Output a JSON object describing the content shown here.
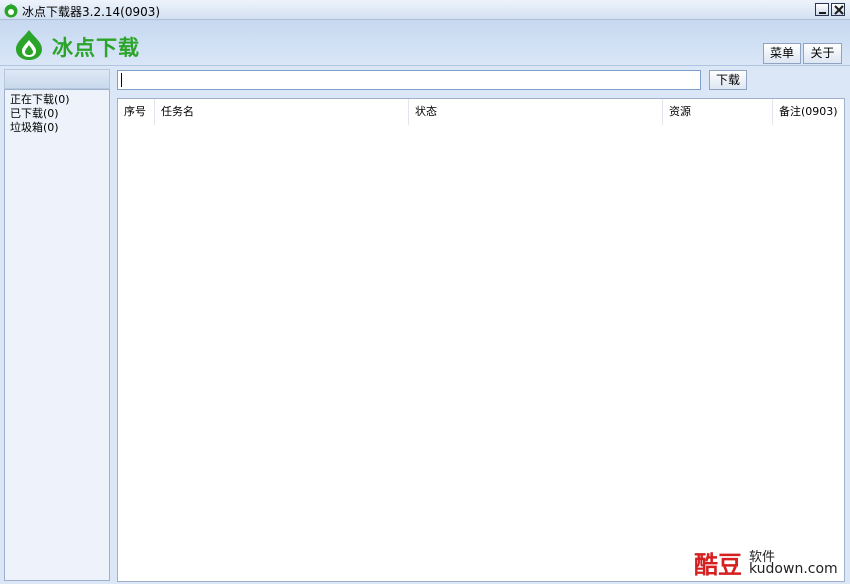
{
  "window": {
    "title": "冰点下载器3.2.14(0903)",
    "minimize_icon": "minimize-icon",
    "close_icon": "close-icon"
  },
  "header": {
    "logo_text": "冰点下载",
    "logo_icon": "drop-leaf-logo-icon",
    "brand_color": "#2aa52a",
    "menu_label": "菜单",
    "about_label": "关于"
  },
  "toolbar": {
    "url_value": "",
    "download_label": "下载"
  },
  "sidebar": {
    "items": [
      {
        "label": "正在下载(0)"
      },
      {
        "label": "已下载(0)"
      },
      {
        "label": "垃圾箱(0)"
      }
    ]
  },
  "table": {
    "columns": [
      "序号",
      "任务名",
      "状态",
      "资源",
      "备注(0903)"
    ],
    "rows": []
  },
  "watermark": {
    "big": "酷豆",
    "small": "软件",
    "url": "kudown.com"
  }
}
